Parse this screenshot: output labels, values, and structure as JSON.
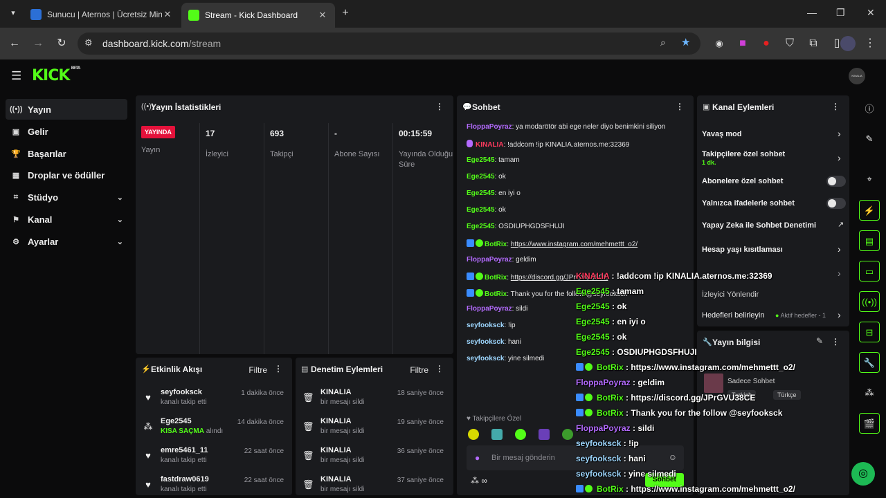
{
  "browser": {
    "tabs": [
      {
        "title": "Sunucu | Aternos | Ücretsiz Min"
      },
      {
        "title": "Stream - Kick Dashboard"
      }
    ],
    "url_host": "dashboard.kick.com",
    "url_path": "/stream"
  },
  "header": {
    "logo": "KICK",
    "beta": "BETA",
    "avatar": "KINALIA"
  },
  "sidebar": {
    "items": [
      {
        "label": "Yayın",
        "icon": "broadcast-icon"
      },
      {
        "label": "Gelir",
        "icon": "revenue-icon"
      },
      {
        "label": "Başarılar",
        "icon": "trophy-icon"
      },
      {
        "label": "Droplar ve ödüller",
        "icon": "gift-icon"
      },
      {
        "label": "Stüdyo",
        "icon": "studio-icon"
      },
      {
        "label": "Kanal",
        "icon": "channel-icon"
      },
      {
        "label": "Ayarlar",
        "icon": "gear-icon"
      }
    ]
  },
  "stats": {
    "title": "Yayın İstatistikleri",
    "live_badge": "YAYINDA",
    "columns": [
      {
        "value": "",
        "label": "Yayın"
      },
      {
        "value": "17",
        "label": "İzleyici"
      },
      {
        "value": "693",
        "label": "Takipçi"
      },
      {
        "value": "-",
        "label": "Abone Sayısı"
      },
      {
        "value": "00:15:59",
        "label": "Yayında Olduğu Süre"
      }
    ]
  },
  "activity": {
    "title": "Etkinlik Akışı",
    "filter": "Filtre",
    "rows": [
      {
        "name": "seyfooksck",
        "sub": "kanalı takip etti",
        "highlight": "",
        "time": "1 dakika önce"
      },
      {
        "name": "Ege2545",
        "sub": " alındı",
        "highlight": "KISA SAÇMA",
        "time": "14 dakika önce"
      },
      {
        "name": "emre5461_11",
        "sub": "kanalı takip etti",
        "highlight": "",
        "time": "22 saat önce"
      },
      {
        "name": "fastdraw0619",
        "sub": "kanalı takip etti",
        "highlight": "",
        "time": "22 saat önce"
      }
    ]
  },
  "moderation": {
    "title": "Denetim Eylemleri",
    "filter": "Filtre",
    "rows": [
      {
        "name": "KINALIA",
        "sub": "bir mesajı sildi",
        "time": "18 saniye önce"
      },
      {
        "name": "KINALIA",
        "sub": "bir mesajı sildi",
        "time": "19 saniye önce"
      },
      {
        "name": "KINALIA",
        "sub": "bir mesajı sildi",
        "time": "36 saniye önce"
      },
      {
        "name": "KINALIA",
        "sub": "bir mesajı sildi",
        "time": "37 saniye önce"
      }
    ]
  },
  "chat": {
    "title": "Sohbet",
    "followers_only": "Takipçilere Özel",
    "input_placeholder": "Bir mesaj gönderin",
    "send": "Sohbet",
    "messages": [
      {
        "user": "FloppaPoyraz",
        "color": "u-purple",
        "text": ": ya modarötör abi ege neler diyo benimkini siliyon",
        "link": ""
      },
      {
        "user": "KINALIA",
        "color": "u-red",
        "text": ": !addcom !ip KINALIA.aternos.me:32369",
        "link": ""
      },
      {
        "user": "Ege2545",
        "color": "u-green",
        "text": ": tamam",
        "link": ""
      },
      {
        "user": "Ege2545",
        "color": "u-green",
        "text": ": ok",
        "link": ""
      },
      {
        "user": "Ege2545",
        "color": "u-green",
        "text": ": en iyi o",
        "link": ""
      },
      {
        "user": "Ege2545",
        "color": "u-green",
        "text": ": ok",
        "link": ""
      },
      {
        "user": "Ege2545",
        "color": "u-green",
        "text": ": OSDIUPHGDSFHUJI",
        "link": ""
      },
      {
        "user": "BotRix",
        "color": "u-green",
        "text": ": ",
        "link": "https://www.instagram.com/mehmettt_o2/"
      },
      {
        "user": "FloppaPoyraz",
        "color": "u-purple",
        "text": ": geldim",
        "link": ""
      },
      {
        "user": "BotRix",
        "color": "u-green",
        "text": ": ",
        "link": "https://discord.gg/JPrGVU38CE"
      },
      {
        "user": "BotRix",
        "color": "u-green",
        "text": ": Thank you for the follow @seyfooksck",
        "link": ""
      },
      {
        "user": "FloppaPoyraz",
        "color": "u-purple",
        "text": ": sildi",
        "link": ""
      },
      {
        "user": "seyfooksck",
        "color": "u-teal",
        "text": ": !ip",
        "link": ""
      },
      {
        "user": "seyfooksck",
        "color": "u-teal",
        "text": ": hani",
        "link": ""
      },
      {
        "user": "seyfooksck",
        "color": "u-teal",
        "text": ": yine silmedi",
        "link": ""
      }
    ]
  },
  "overlay": {
    "lines": [
      {
        "user": "KINALIA",
        "color": "u-red",
        "text": " : !addcom !ip KINALIA.aternos.me:32369"
      },
      {
        "user": "Ege2545",
        "color": "u-green",
        "text": " : tamam"
      },
      {
        "user": "Ege2545",
        "color": "u-green",
        "text": " : ok"
      },
      {
        "user": "Ege2545",
        "color": "u-green",
        "text": " : en iyi o"
      },
      {
        "user": "Ege2545",
        "color": "u-green",
        "text": " : ok"
      },
      {
        "user": "Ege2545",
        "color": "u-green",
        "text": " : OSDIUPHGDSFHUJI"
      },
      {
        "user": "BotRix",
        "color": "u-green",
        "text": " : https://www.instagram.com/mehmettt_o2/"
      },
      {
        "user": "FloppaPoyraz",
        "color": "u-purple",
        "text": " : geldim"
      },
      {
        "user": "BotRix",
        "color": "u-green",
        "text": " : https://discord.gg/JPrGVU38CE"
      },
      {
        "user": "BotRix",
        "color": "u-green",
        "text": " : Thank you for the follow @seyfooksck"
      },
      {
        "user": "FloppaPoyraz",
        "color": "u-purple",
        "text": " : sildi"
      },
      {
        "user": "seyfooksck",
        "color": "u-teal",
        "text": " : !ip"
      },
      {
        "user": "seyfooksck",
        "color": "u-teal",
        "text": " : hani"
      },
      {
        "user": "seyfooksck",
        "color": "u-teal",
        "text": " : yine silmedi"
      },
      {
        "user": "BotRix",
        "color": "u-green",
        "text": " : https://www.instagram.com/mehmettt_o2/"
      }
    ]
  },
  "channel_actions": {
    "title": "Kanal Eylemleri",
    "slow_mode": "Yavaş mod",
    "followers_chat": "Takipçilere özel sohbet",
    "followers_chat_value": "1 dk.",
    "subs_chat": "Abonelere özel sohbet",
    "emotes_chat": "Yalnızca ifadelerle sohbet",
    "ai_moderation": "Yapay Zeka ile Sohbet Denetimi",
    "account_age": "Hesap yaşı kısıtlaması",
    "viewer_redirect": "İzleyici Yönlendir",
    "set_targets": "Hedefleri belirleyin",
    "active_targets": "Aktif hedefler - 1"
  },
  "stream_info": {
    "title": "Yayın bilgisi",
    "category": "Sadece Sohbet",
    "tags": [
      "Turkish",
      "Türkçe"
    ]
  },
  "colors": {
    "accent": "#53fc18",
    "live": "#e4123b",
    "panel": "#1a1b1e"
  }
}
